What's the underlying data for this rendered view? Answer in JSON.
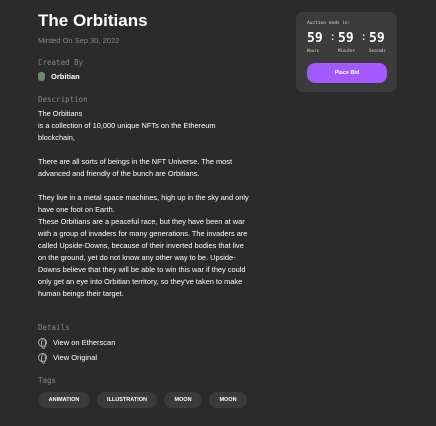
{
  "title": "The Orbitians",
  "minted": "Minted On Sep 30, 2022",
  "created_by_label": "Created By",
  "creator": "Orbitian",
  "description_label": "Description",
  "description": "The Orbitians\nis a collection of 10,000 unique NFTs on the Ethereum blockchain,\n\nThere are all sorts of beings in the NFT Universe. The most advanced and friendly of the bunch are Orbitians.\n\nThey live in a metal space machines, high up in the sky and only have one foot on Earth.\nThese Orbitians are a peaceful race, but they have been at war with a group of invaders for many generations. The invaders are called Upside-Downs, because of their inverted bodies that live on the ground, yet do not know any other way to be. Upside-Downs believe that they will be able to win this war if they could only get an eye into Orbitian territory, so they've taken to make human beings their target.",
  "details_label": "Details",
  "links": [
    "View on Etherscan",
    "View Original"
  ],
  "tags_label": "Tags",
  "tags": [
    "ANIMATION",
    "ILLUSTRATION",
    "MOON",
    "MOON"
  ],
  "auction": {
    "label": "Auction ends in:",
    "hours": "59",
    "minutes": "59",
    "seconds": "59",
    "hours_label": "Hours",
    "minutes_label": "Minutes",
    "seconds_label": "Seconds",
    "separator": ":",
    "bid_label": "Place Bid"
  },
  "colors": {
    "background": "#2b2b2b",
    "card": "#3b3b3b",
    "accent": "#a259ff"
  }
}
